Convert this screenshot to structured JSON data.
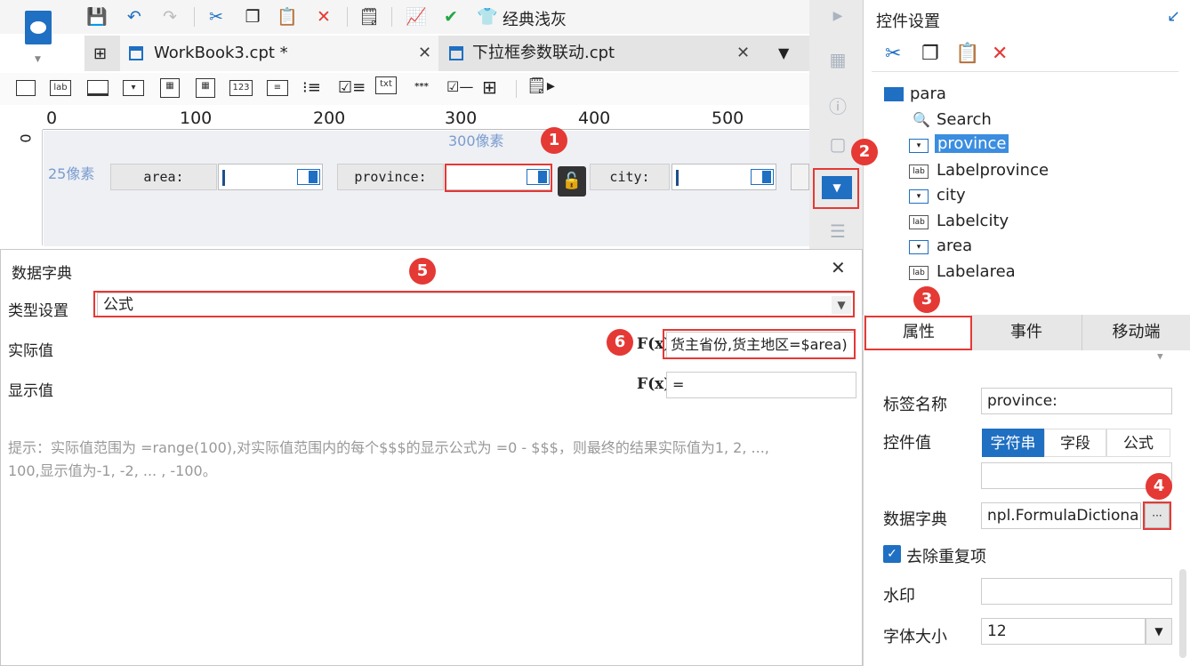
{
  "toolbar": {
    "theme_label": "经典浅灰"
  },
  "tabs": [
    {
      "label": "WorkBook3.cpt *",
      "active": true
    },
    {
      "label": "下拉框参数联动.cpt",
      "active": false
    }
  ],
  "widget_bar": {
    "items": [
      "lab",
      "123",
      "txt",
      "***"
    ]
  },
  "ruler": {
    "ticks": [
      "0",
      "100",
      "200",
      "300",
      "400",
      "500"
    ],
    "vertical_zero": "0"
  },
  "canvas": {
    "width_note": "300像素",
    "height_note": "25像素",
    "labels": [
      "area:",
      "province:",
      "city:"
    ]
  },
  "right_panel": {
    "title": "控件设置",
    "tree": {
      "root": "para",
      "items": [
        "Search",
        "province",
        "Labelprovince",
        "city",
        "Labelcity",
        "area",
        "Labelarea"
      ],
      "selected": "province"
    },
    "tabs": [
      "属性",
      "事件",
      "移动端"
    ],
    "active_tab": "属性",
    "props": {
      "label_name_label": "标签名称",
      "label_name_value": "province:",
      "widget_value_label": "控件值",
      "widget_value_options": [
        "字符串",
        "字段",
        "公式"
      ],
      "widget_value_selected": "字符串",
      "dictionary_label": "数据字典",
      "dictionary_value": "npl.FormulaDictionary",
      "dictionary_button": "···",
      "dedupe_label": "去除重复项",
      "dedupe_checked": true,
      "watermark_label": "水印",
      "font_size_label": "字体大小",
      "font_size_value": "12"
    }
  },
  "dialog": {
    "title": "数据字典",
    "type_label": "类型设置",
    "type_value": "公式",
    "actual_label": "实际值",
    "actual_value": "货主省份,货主地区=$area)",
    "display_label": "显示值",
    "display_value": "=",
    "fx": "F(x)",
    "hint_line1": "提示：实际值范围为 =range(100),对实际值范围内的每个$$$的显示公式为 =0 - $$$，则最终的结果实际值为1, 2, ...,",
    "hint_line2": "100,显示值为-1, -2, ... , -100。",
    "close": "✕"
  },
  "callouts": [
    "1",
    "2",
    "3",
    "4",
    "5",
    "6"
  ],
  "colors": {
    "accent": "#1f6fc2",
    "callout_red": "#e53935",
    "selected_bg": "#3b8de0"
  }
}
